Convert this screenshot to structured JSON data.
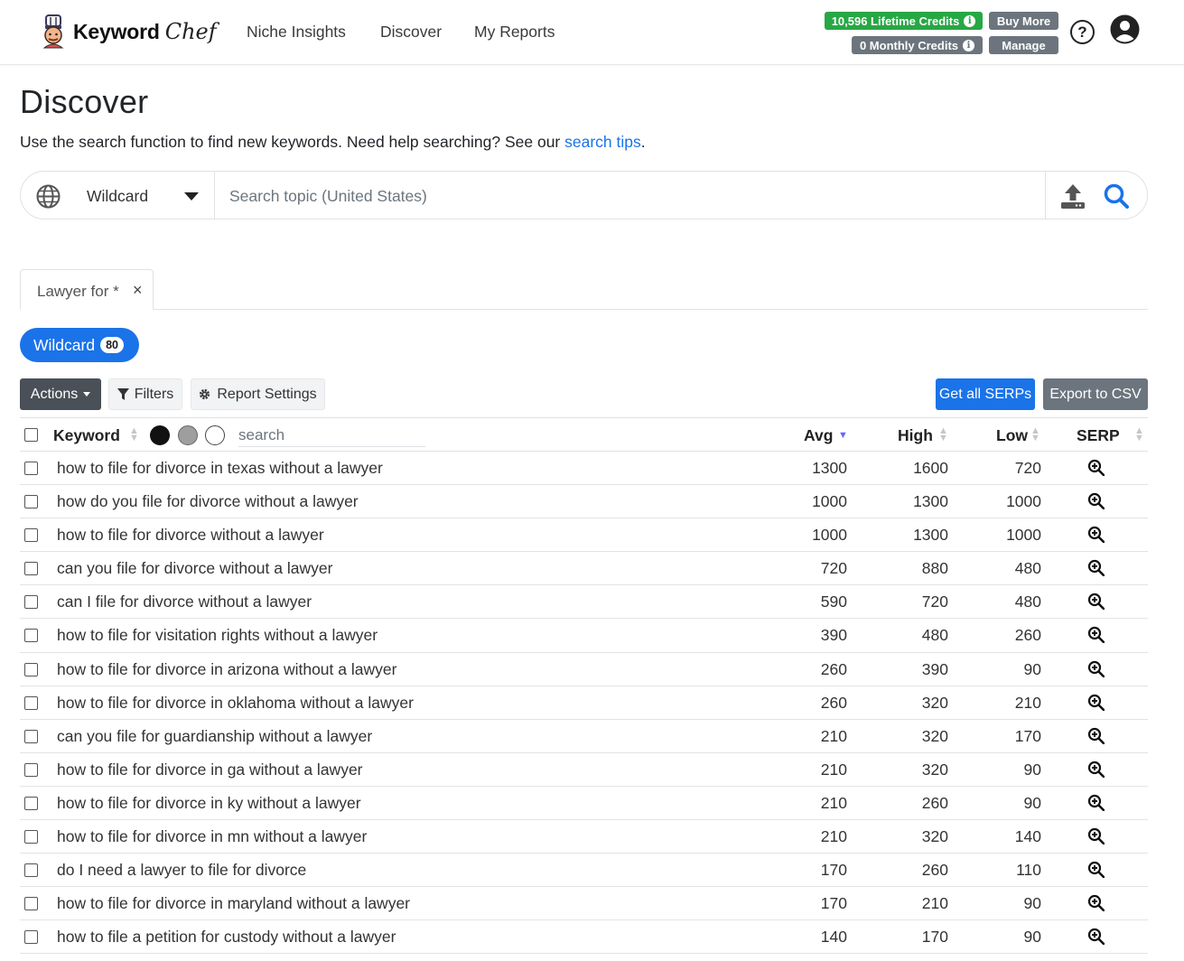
{
  "nav": {
    "brand_word": "Keyword",
    "brand_script": "Chef",
    "links": [
      "Niche Insights",
      "Discover",
      "My Reports"
    ],
    "lifetime_credits": "10,596 Lifetime Credits",
    "monthly_credits": "0 Monthly Credits",
    "buy_more": "Buy More",
    "manage": "Manage",
    "help_glyph": "?"
  },
  "page": {
    "title": "Discover",
    "subtitle": "Use the search function to find new keywords. Need help searching? See our",
    "subtitle_link": "search tips",
    "subtitle_end": "."
  },
  "search": {
    "mode": "Wildcard",
    "placeholder": "Search topic (United States)",
    "value": ""
  },
  "tabs": [
    {
      "label": "Lawyer for *",
      "close": "×"
    }
  ],
  "filter_pill": {
    "label": "Wildcard",
    "count": "80"
  },
  "toolbar": {
    "actions": "Actions",
    "filters": "Filters",
    "report_settings": "Report Settings",
    "get_serps": "Get all SERPs",
    "export": "Export to CSV"
  },
  "table": {
    "headers": {
      "keyword": "Keyword",
      "avg": "Avg",
      "high": "High",
      "low": "Low",
      "serp": "SERP"
    },
    "search_placeholder": "search",
    "swatch_colors": [
      "#111111",
      "#9e9e9e",
      "#ffffff"
    ],
    "accent": "#1a73e8",
    "rows": [
      {
        "keyword": "how to file for divorce in texas without a lawyer",
        "avg": "1300",
        "high": "1600",
        "low": "720"
      },
      {
        "keyword": "how do you file for divorce without a lawyer",
        "avg": "1000",
        "high": "1300",
        "low": "1000"
      },
      {
        "keyword": "how to file for divorce without a lawyer",
        "avg": "1000",
        "high": "1300",
        "low": "1000"
      },
      {
        "keyword": "can you file for divorce without a lawyer",
        "avg": "720",
        "high": "880",
        "low": "480"
      },
      {
        "keyword": "can I file for divorce without a lawyer",
        "avg": "590",
        "high": "720",
        "low": "480"
      },
      {
        "keyword": "how to file for visitation rights without a lawyer",
        "avg": "390",
        "high": "480",
        "low": "260"
      },
      {
        "keyword": "how to file for divorce in arizona without a lawyer",
        "avg": "260",
        "high": "390",
        "low": "90"
      },
      {
        "keyword": "how to file for divorce in oklahoma without a lawyer",
        "avg": "260",
        "high": "320",
        "low": "210"
      },
      {
        "keyword": "can you file for guardianship without a lawyer",
        "avg": "210",
        "high": "320",
        "low": "170"
      },
      {
        "keyword": "how to file for divorce in ga without a lawyer",
        "avg": "210",
        "high": "320",
        "low": "90"
      },
      {
        "keyword": "how to file for divorce in ky without a lawyer",
        "avg": "210",
        "high": "260",
        "low": "90"
      },
      {
        "keyword": "how to file for divorce in mn without a lawyer",
        "avg": "210",
        "high": "320",
        "low": "140"
      },
      {
        "keyword": "do I need a lawyer to file for divorce",
        "avg": "170",
        "high": "260",
        "low": "110"
      },
      {
        "keyword": "how to file for divorce in maryland without a lawyer",
        "avg": "170",
        "high": "210",
        "low": "90"
      },
      {
        "keyword": "how to file a petition for custody without a lawyer",
        "avg": "140",
        "high": "170",
        "low": "90"
      }
    ]
  }
}
